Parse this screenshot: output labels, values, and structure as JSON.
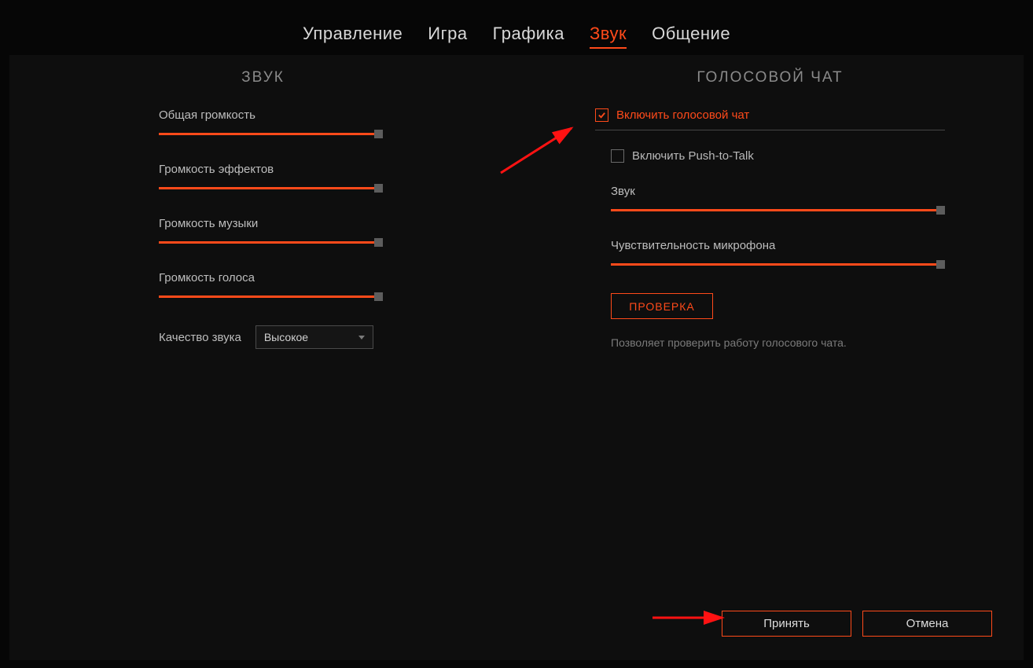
{
  "tabs": {
    "items": [
      {
        "label": "Управление"
      },
      {
        "label": "Игра"
      },
      {
        "label": "Графика"
      },
      {
        "label": "Звук"
      },
      {
        "label": "Общение"
      }
    ],
    "active_index": 3
  },
  "left": {
    "title": "ЗВУК",
    "sliders": [
      {
        "label": "Общая громкость",
        "value": 100
      },
      {
        "label": "Громкость эффектов",
        "value": 100
      },
      {
        "label": "Громкость музыки",
        "value": 100
      },
      {
        "label": "Громкость голоса",
        "value": 100
      }
    ],
    "quality_label": "Качество звука",
    "quality_value": "Высокое"
  },
  "right": {
    "title": "ГОЛОСОВОЙ ЧАТ",
    "enable_voice": {
      "label": "Включить голосовой чат",
      "checked": true
    },
    "push_to_talk": {
      "label": "Включить Push-to-Talk",
      "checked": false
    },
    "sliders": [
      {
        "label": "Звук",
        "value": 100
      },
      {
        "label": "Чувствительность микрофона",
        "value": 100
      }
    ],
    "test_button": "ПРОВЕРКА",
    "test_desc": "Позволяет проверить работу голосового чата."
  },
  "footer": {
    "accept": "Принять",
    "cancel": "Отмена"
  },
  "colors": {
    "accent": "#ff4a1a"
  }
}
